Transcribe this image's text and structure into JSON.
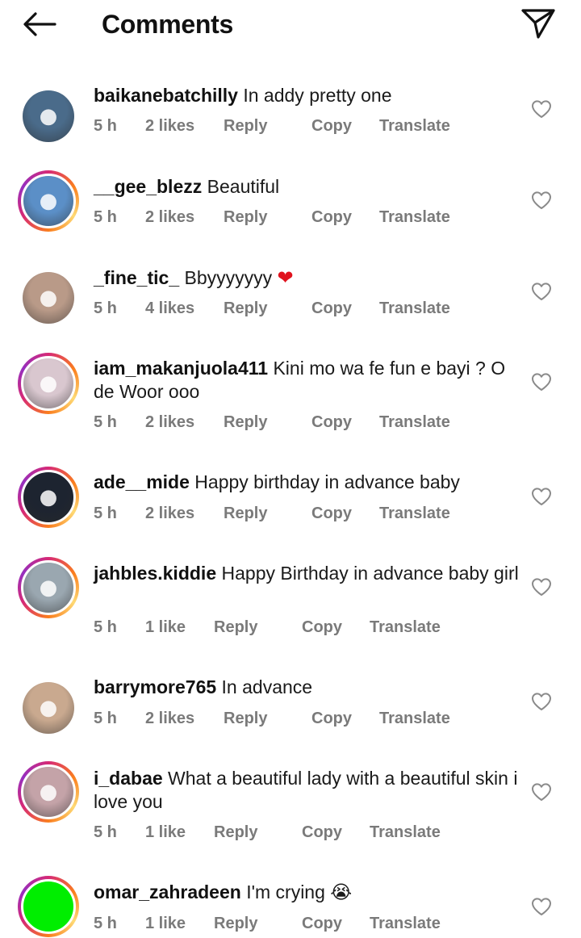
{
  "header": {
    "title": "Comments",
    "back_icon": "arrow-left-icon",
    "share_icon": "paper-plane-icon"
  },
  "comments": [
    {
      "username": "baikanebatchilly",
      "text": "In addy pretty one",
      "time": "5 h",
      "likes": "2 likes",
      "reply": "Reply",
      "copy": "Copy",
      "translate": "Translate",
      "story_ring": false,
      "avatar_color": "#4a6b8a"
    },
    {
      "username": "__gee_blezz",
      "text": "Beautiful",
      "time": "5 h",
      "likes": "2 likes",
      "reply": "Reply",
      "copy": "Copy",
      "translate": "Translate",
      "story_ring": true,
      "avatar_color": "#5b8fc7"
    },
    {
      "username": "_fine_tic_",
      "text": "Bbyyyyyyy",
      "emoji": "❤",
      "time": "5 h",
      "likes": "4 likes",
      "reply": "Reply",
      "copy": "Copy",
      "translate": "Translate",
      "story_ring": false,
      "avatar_color": "#b99a88"
    },
    {
      "username": "iam_makanjuola411",
      "text": "Kini mo wa fe fun e bayi ? O de Woor ooo",
      "time": "5 h",
      "likes": "2 likes",
      "reply": "Reply",
      "copy": "Copy",
      "translate": "Translate",
      "story_ring": true,
      "avatar_color": "#d9c7cf"
    },
    {
      "username": "ade__mide",
      "text": "Happy birthday in advance baby",
      "time": "5 h",
      "likes": "2 likes",
      "reply": "Reply",
      "copy": "Copy",
      "translate": "Translate",
      "story_ring": true,
      "avatar_color": "#1d2430"
    },
    {
      "username": "jahbles.kiddie",
      "text": "Happy  Birthday in advance baby girl",
      "time": "5 h",
      "likes": "1 like",
      "reply": "Reply",
      "copy": "Copy",
      "translate": "Translate",
      "story_ring": true,
      "avatar_color": "#9aa7b0"
    },
    {
      "username": "barrymore765",
      "text": "In advance",
      "time": "5 h",
      "likes": "2 likes",
      "reply": "Reply",
      "copy": "Copy",
      "translate": "Translate",
      "story_ring": false,
      "avatar_color": "#c9a98f"
    },
    {
      "username": "i_dabae",
      "text": "What a beautiful lady with a beautiful skin i love you",
      "time": "5 h",
      "likes": "1 like",
      "reply": "Reply",
      "copy": "Copy",
      "translate": "Translate",
      "story_ring": true,
      "avatar_color": "#c4a3a8"
    },
    {
      "username": "omar_zahradeen",
      "text": "I'm crying",
      "emoji": "😭",
      "time": "5 h",
      "likes": "1 like",
      "reply": "Reply",
      "copy": "Copy",
      "translate": "Translate",
      "story_ring": true,
      "avatar_color": "#00ee00"
    }
  ]
}
